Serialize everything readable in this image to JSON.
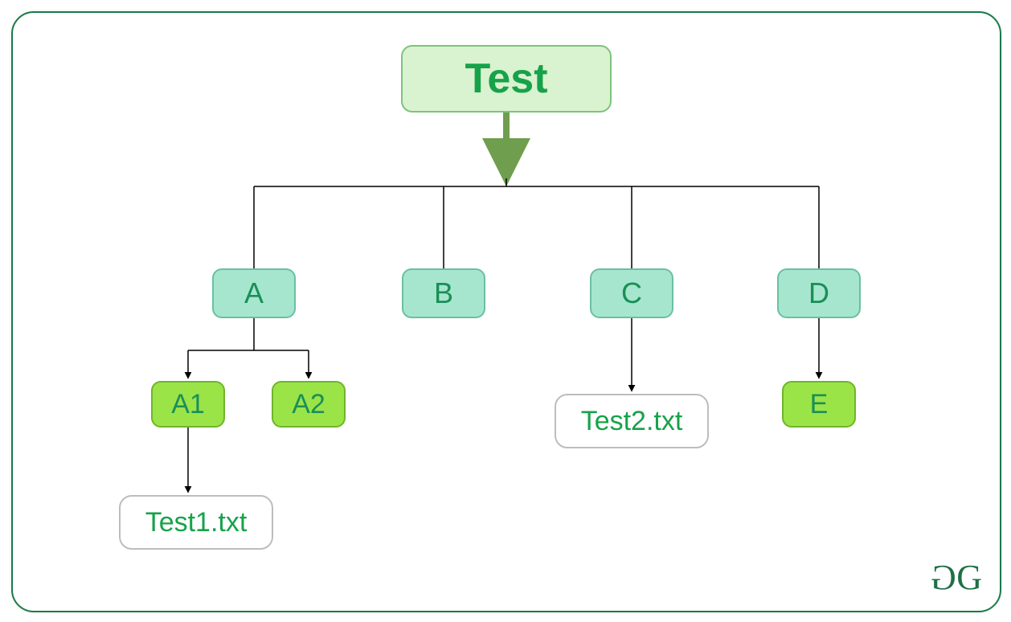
{
  "diagram": {
    "root": {
      "label": "Test"
    },
    "level1": {
      "A": {
        "label": "A"
      },
      "B": {
        "label": "B"
      },
      "C": {
        "label": "C"
      },
      "D": {
        "label": "D"
      }
    },
    "level2": {
      "A1": {
        "label": "A1"
      },
      "A2": {
        "label": "A2"
      },
      "E": {
        "label": "E"
      }
    },
    "files": {
      "f1": {
        "label": "Test1.txt"
      },
      "f2": {
        "label": "Test2.txt"
      }
    }
  },
  "brand": {
    "g1": "G",
    "g2": "G"
  },
  "colors": {
    "border_green": "#1a7a4a",
    "root_fill": "#d9f2d0",
    "root_border": "#7cc47c",
    "level1_fill": "#a6e6cf",
    "level1_border": "#6bbfa2",
    "level2_fill": "#9be447",
    "level2_border": "#6fb52a",
    "text_green": "#17a24a",
    "arrow_olive": "#6f9e4e"
  }
}
